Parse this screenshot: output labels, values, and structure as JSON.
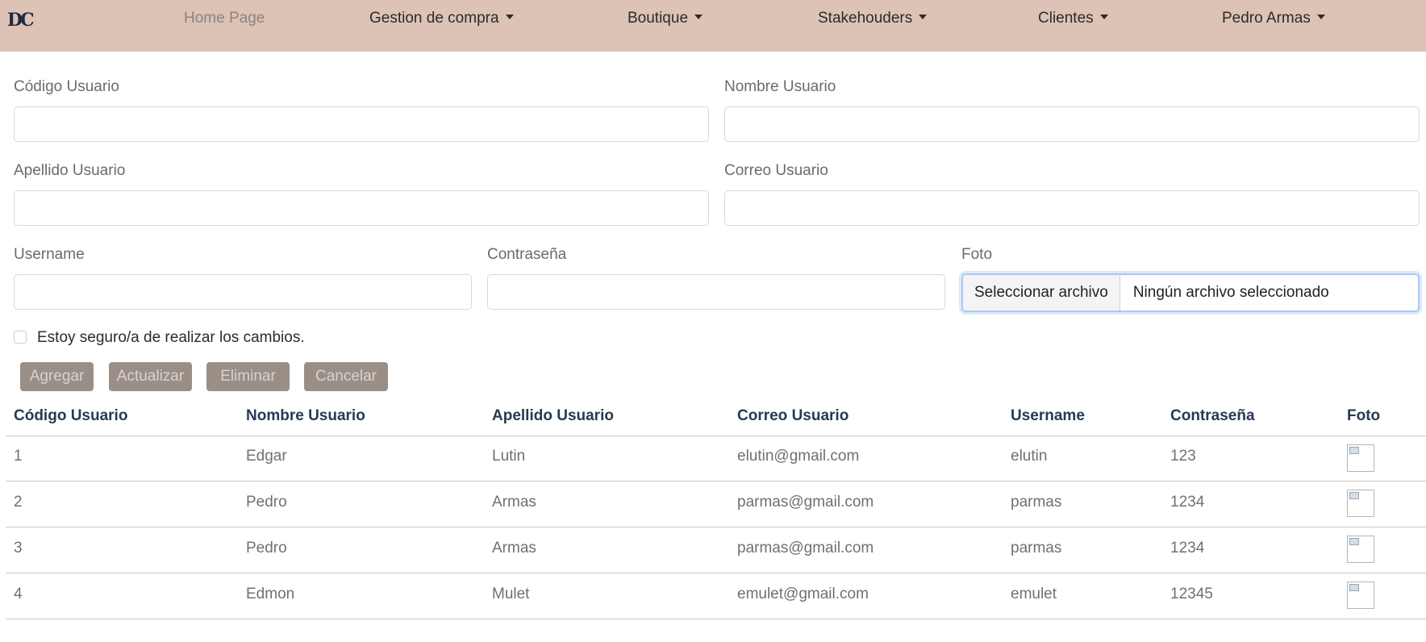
{
  "nav": {
    "brand": "DC",
    "items": [
      "Home Page",
      "Gestion de compra",
      "Boutique",
      "Stakehouders",
      "Clientes",
      "Pedro Armas"
    ]
  },
  "form": {
    "codigo_label": "Código Usuario",
    "nombre_label": "Nombre Usuario",
    "apellido_label": "Apellido Usuario",
    "correo_label": "Correo Usuario",
    "username_label": "Username",
    "password_label": "Contraseña",
    "foto_label": "Foto",
    "file_button": "Seleccionar archivo",
    "file_status": "Ningún archivo seleccionado",
    "confirm_label": "Estoy seguro/a de realizar los cambios."
  },
  "buttons": [
    "Agregar",
    "Actualizar",
    "Eliminar",
    "Cancelar"
  ],
  "table": {
    "headers": [
      "Código Usuario",
      "Nombre Usuario",
      "Apellido Usuario",
      "Correo Usuario",
      "Username",
      "Contraseña",
      "Foto"
    ],
    "rows": [
      [
        "1",
        "Edgar",
        "Lutin",
        "elutin@gmail.com",
        "elutin",
        "123"
      ],
      [
        "2",
        "Pedro",
        "Armas",
        "parmas@gmail.com",
        "parmas",
        "1234"
      ],
      [
        "3",
        "Pedro",
        "Armas",
        "parmas@gmail.com",
        "parmas",
        "1234"
      ],
      [
        "4",
        "Edmon",
        "Mulet",
        "emulet@gmail.com",
        "emulet",
        "12345"
      ]
    ]
  },
  "colors": {
    "navbar": "#dcc3b5",
    "button": "#9a8f87",
    "header_text": "#263a55"
  }
}
